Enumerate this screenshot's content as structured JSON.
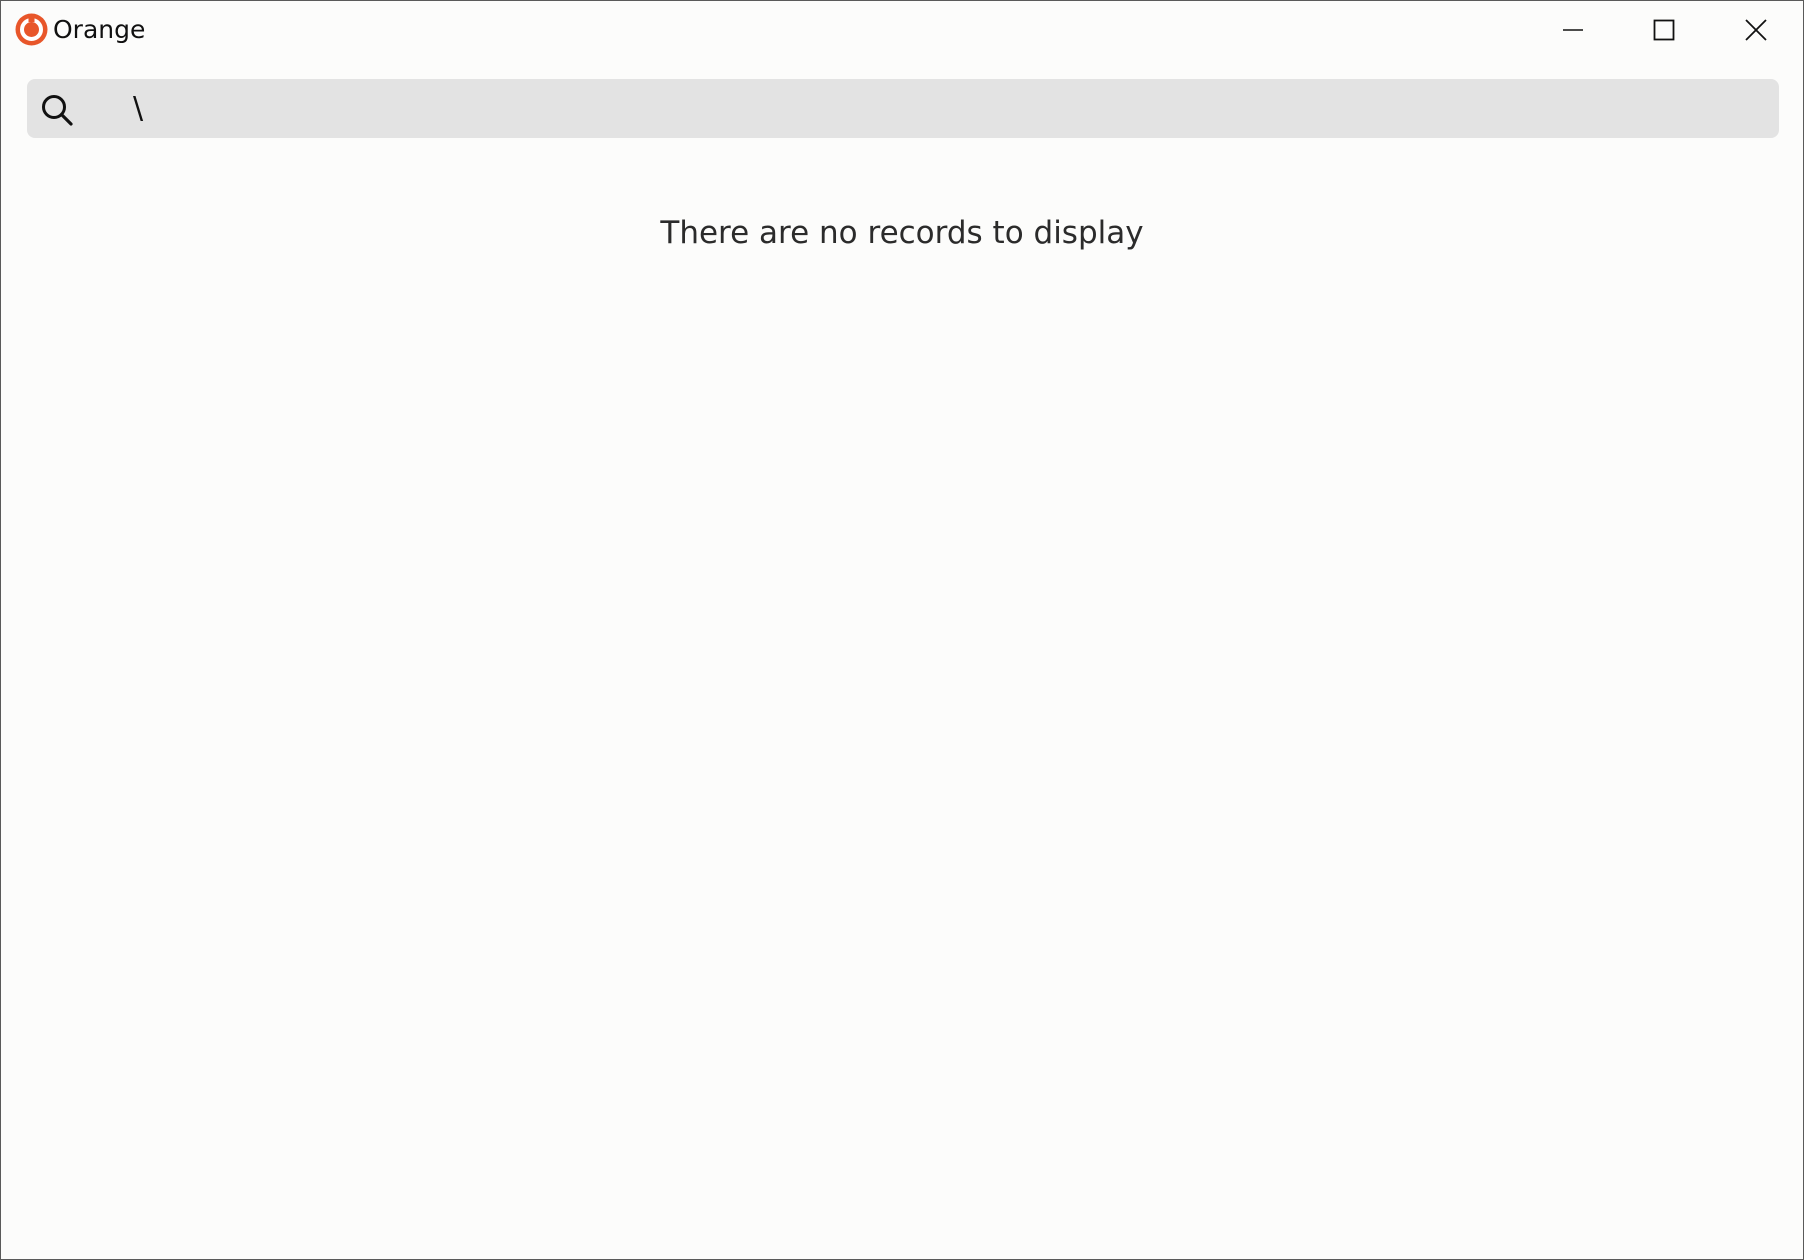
{
  "window": {
    "title": "Orange",
    "accent_color": "#e8562a",
    "controls": {
      "minimize_icon": "minimize-icon",
      "maximize_icon": "maximize-icon",
      "close_icon": "close-icon"
    }
  },
  "search": {
    "icon": "search-icon",
    "value": "\\",
    "placeholder": ""
  },
  "content": {
    "empty_message": "There are no records to display"
  }
}
